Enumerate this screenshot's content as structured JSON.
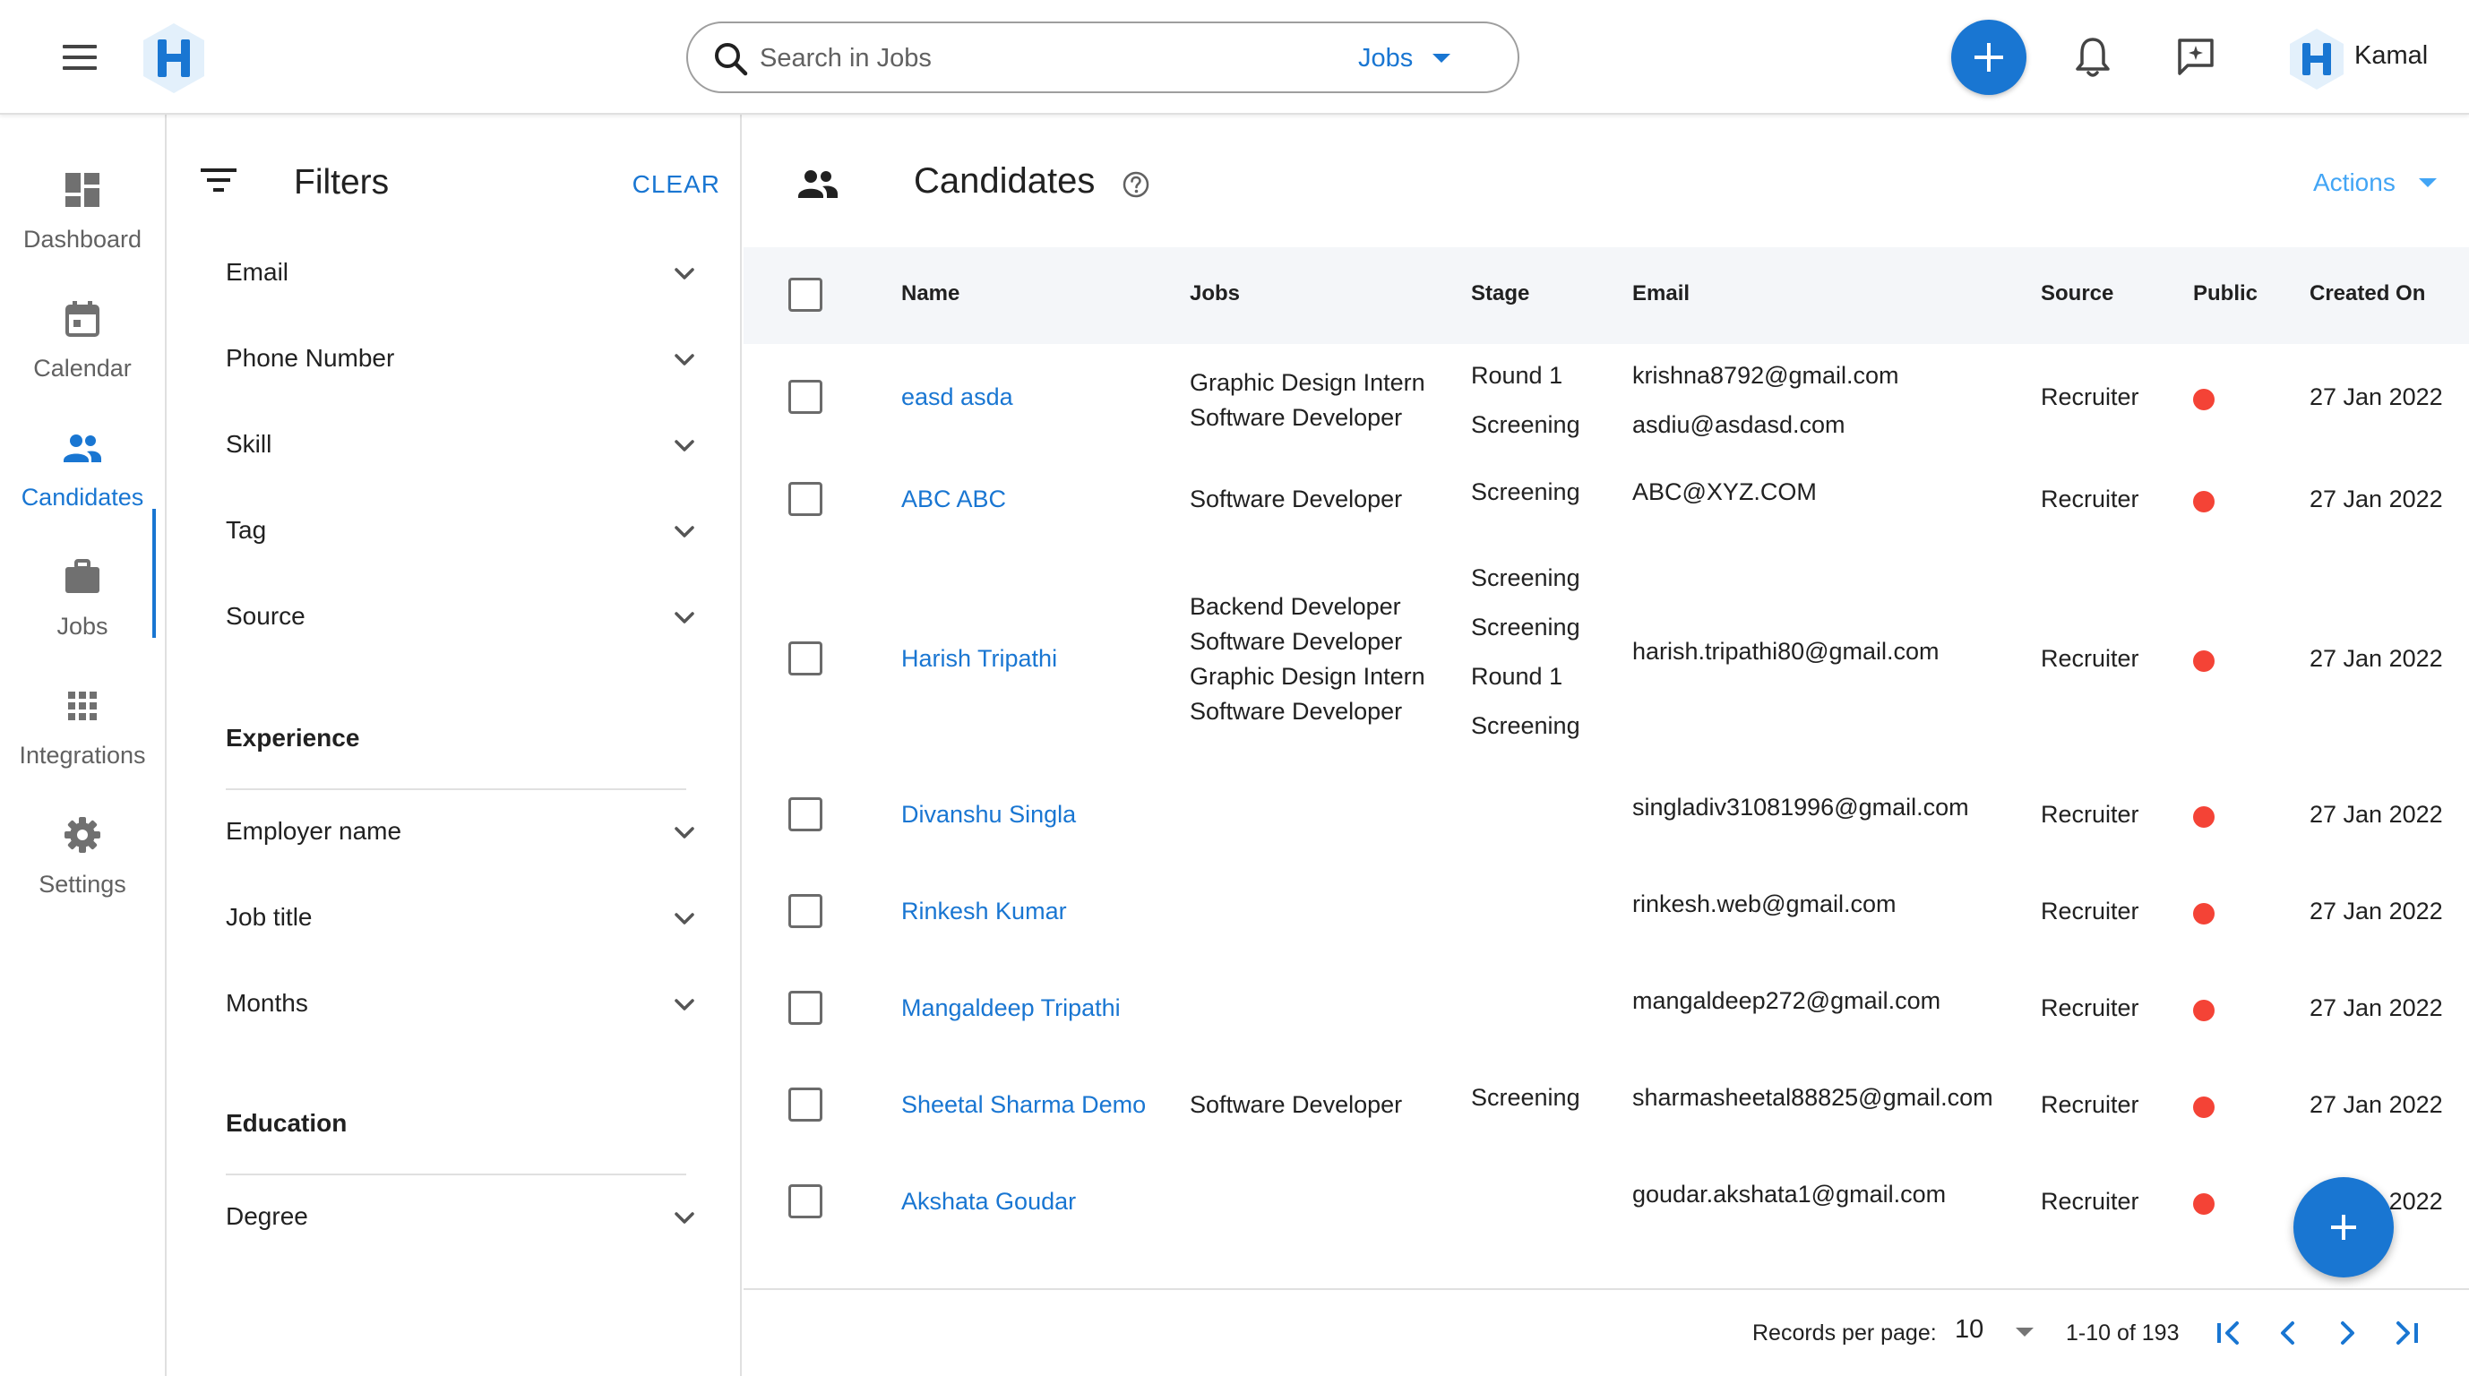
{
  "topbar": {
    "search_placeholder": "Search in Jobs",
    "search_scope": "Jobs",
    "user_name": "Kamal"
  },
  "nav": {
    "items": [
      {
        "label": "Dashboard",
        "icon": "dashboard-icon"
      },
      {
        "label": "Calendar",
        "icon": "calendar-icon"
      },
      {
        "label": "Candidates",
        "icon": "people-icon",
        "active": true
      },
      {
        "label": "Jobs",
        "icon": "briefcase-icon"
      },
      {
        "label": "Integrations",
        "icon": "apps-grid-icon"
      },
      {
        "label": "Settings",
        "icon": "gear-icon"
      }
    ]
  },
  "filters": {
    "title": "Filters",
    "clear_label": "CLEAR",
    "basic": [
      "Email",
      "Phone Number",
      "Skill",
      "Tag",
      "Source"
    ],
    "experience_title": "Experience",
    "experience": [
      "Employer name",
      "Job title",
      "Months"
    ],
    "education_title": "Education",
    "education": [
      "Degree"
    ]
  },
  "main": {
    "title": "Candidates",
    "actions_label": "Actions",
    "columns": {
      "name": "Name",
      "jobs": "Jobs",
      "stage": "Stage",
      "email": "Email",
      "source": "Source",
      "public": "Public",
      "created": "Created On"
    },
    "rows": [
      {
        "name": "easd asda",
        "jobs": [
          "Graphic Design Intern",
          "Software Developer"
        ],
        "stages": [
          "Round 1",
          "Screening"
        ],
        "emails": [
          "krishna8792@gmail.com",
          "asdiu@asdasd.com"
        ],
        "source": "Recruiter",
        "created": "27 Jan 2022"
      },
      {
        "name": "ABC ABC",
        "jobs": [
          "Software Developer"
        ],
        "stages": [
          "Screening"
        ],
        "emails": [
          "ABC@XYZ.COM"
        ],
        "source": "Recruiter",
        "created": "27 Jan 2022"
      },
      {
        "name": "Harish Tripathi",
        "jobs": [
          "Backend Developer",
          "Software Developer",
          "Graphic Design Intern",
          "Software Developer"
        ],
        "stages": [
          "Screening",
          "Screening",
          "Round 1",
          "Screening"
        ],
        "emails": [
          "harish.tripathi80@gmail.com"
        ],
        "source": "Recruiter",
        "created": "27 Jan 2022"
      },
      {
        "name": "Divanshu Singla",
        "jobs": [],
        "stages": [],
        "emails": [
          "singladiv31081996@gmail.com"
        ],
        "source": "Recruiter",
        "created": "27 Jan 2022"
      },
      {
        "name": "Rinkesh Kumar",
        "jobs": [],
        "stages": [],
        "emails": [
          "rinkesh.web@gmail.com"
        ],
        "source": "Recruiter",
        "created": "27 Jan 2022"
      },
      {
        "name": "Mangaldeep Tripathi",
        "jobs": [],
        "stages": [],
        "emails": [
          "mangaldeep272@gmail.com"
        ],
        "source": "Recruiter",
        "created": "27 Jan 2022"
      },
      {
        "name": "Sheetal Sharma Demo",
        "jobs": [
          "Software Developer"
        ],
        "stages": [
          "Screening"
        ],
        "emails": [
          "sharmasheetal88825@gmail.com"
        ],
        "source": "Recruiter",
        "created": "27 Jan 2022"
      },
      {
        "name": "Akshata Goudar",
        "jobs": [],
        "stages": [],
        "emails": [
          "goudar.akshata1@gmail.com"
        ],
        "source": "Recruiter",
        "created": "27 Jan 2022"
      }
    ]
  },
  "pagination": {
    "records_label": "Records per page:",
    "per_page": "10",
    "range": "1-10 of 193"
  },
  "colors": {
    "accent": "#1976d2",
    "public_dot": "#f44336",
    "header_bg": "#f4f6f9"
  }
}
